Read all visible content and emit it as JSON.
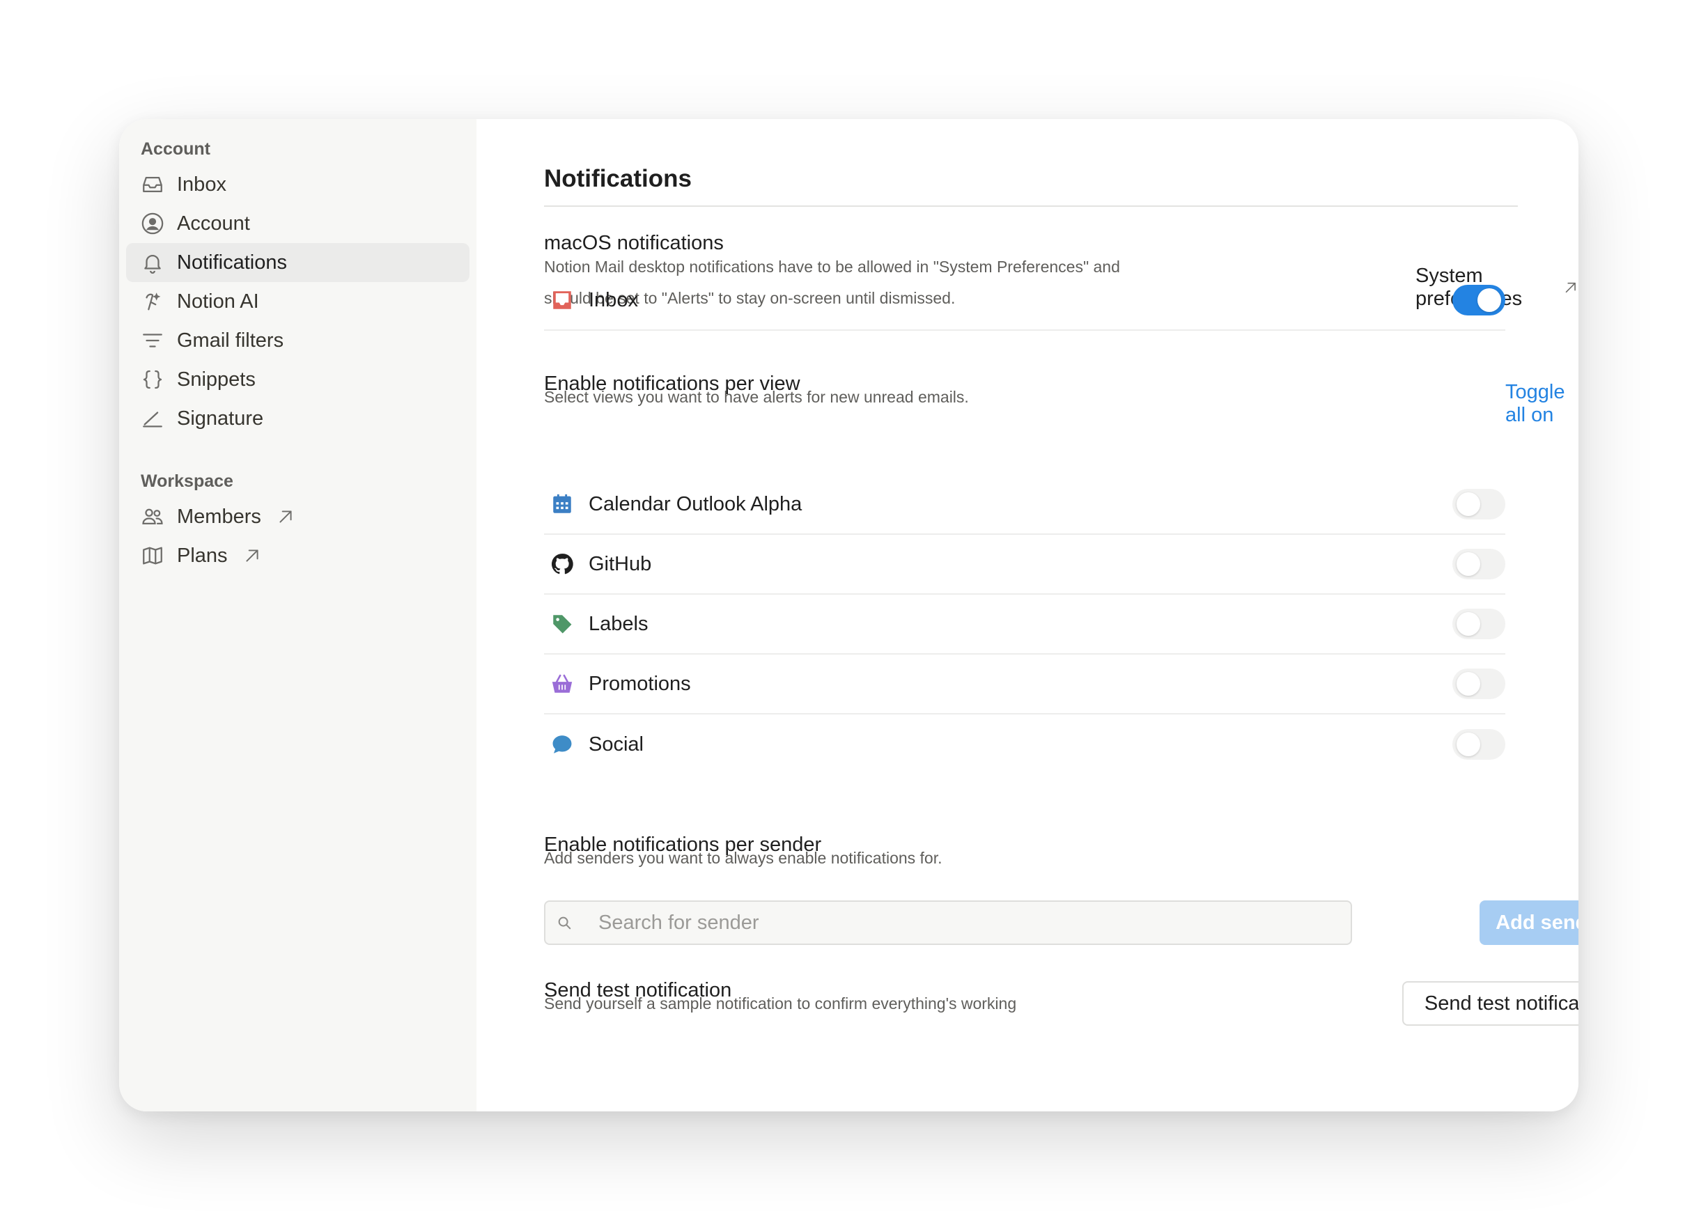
{
  "sidebar": {
    "account_heading": "Account",
    "account_items": [
      {
        "label": "Inbox",
        "icon": "inbox-icon"
      },
      {
        "label": "Account",
        "icon": "account-icon"
      },
      {
        "label": "Notifications",
        "icon": "bell-icon",
        "active": true
      },
      {
        "label": "Notion AI",
        "icon": "notion-ai-icon"
      },
      {
        "label": "Gmail filters",
        "icon": "filter-icon"
      },
      {
        "label": "Snippets",
        "icon": "braces-icon"
      },
      {
        "label": "Signature",
        "icon": "signature-icon"
      }
    ],
    "workspace_heading": "Workspace",
    "workspace_items": [
      {
        "label": "Members",
        "icon": "members-icon",
        "external": true
      },
      {
        "label": "Plans",
        "icon": "map-icon",
        "external": true
      }
    ]
  },
  "main": {
    "title": "Notifications",
    "macos": {
      "title": "macOS notifications",
      "desc_line1": "Notion Mail desktop notifications have to be allowed in \"System Preferences\" and",
      "desc_line2": "should be set to \"Alerts\" to stay on-screen until dismissed.",
      "link_label": "System preferences"
    },
    "per_view": {
      "title": "Enable notifications per view",
      "desc": "Select views you want to have alerts for new unread emails.",
      "toggle_all_label": "Toggle all on",
      "views": [
        {
          "label": "Inbox",
          "icon": "inbox-tray-icon",
          "on": true
        },
        {
          "label": "Calendar Outlook Alpha",
          "icon": "calendar-icon",
          "on": false
        },
        {
          "label": "GitHub",
          "icon": "github-icon",
          "on": false
        },
        {
          "label": "Labels",
          "icon": "tag-icon",
          "on": false
        },
        {
          "label": "Promotions",
          "icon": "basket-icon",
          "on": false
        },
        {
          "label": "Social",
          "icon": "chat-bubble-icon",
          "on": false
        }
      ]
    },
    "per_sender": {
      "title": "Enable notifications per sender",
      "desc": "Add senders you want to always enable notifications for.",
      "search_placeholder": "Search for sender",
      "search_value": "",
      "add_button": "Add senders"
    },
    "test": {
      "title": "Send test notification",
      "desc": "Send yourself a sample notification to confirm everything's working",
      "button": "Send test notification"
    }
  },
  "colors": {
    "accent": "#2383e2",
    "sidebar_bg": "#f7f7f5",
    "active_item_bg": "#ebebea",
    "add_button_bg": "#a7cdf3",
    "inbox_icon": "#e16259",
    "calendar_icon": "#3b7fc4",
    "tag_icon": "#4f9768",
    "basket_icon": "#9a6dd7",
    "chat_icon": "#3e8cc7"
  }
}
